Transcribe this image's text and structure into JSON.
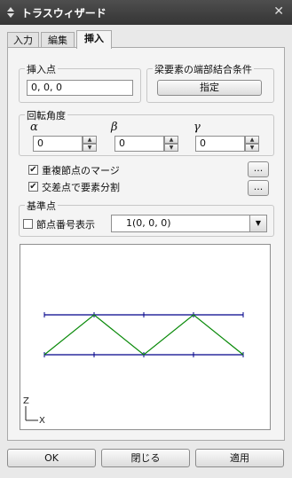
{
  "window": {
    "title": "トラスウィザード",
    "close_glyph": "✕"
  },
  "tabs": [
    {
      "label": "入力"
    },
    {
      "label": "編集"
    },
    {
      "label": "挿入"
    }
  ],
  "insert_point": {
    "title": "挿入点",
    "value": "0, 0, 0"
  },
  "beam_end": {
    "title": "梁要素の端部結合条件",
    "button_label": "指定"
  },
  "rotation": {
    "title": "回転角度",
    "alpha": {
      "symbol": "α",
      "value": "0"
    },
    "beta": {
      "symbol": "β",
      "value": "0"
    },
    "gamma": {
      "symbol": "γ",
      "value": "0"
    }
  },
  "options": {
    "merge_label": "重複節点のマージ",
    "merge_checked": true,
    "split_label": "交差点で要素分割",
    "split_checked": true,
    "more_button_label": "..."
  },
  "base_point": {
    "title": "基準点",
    "show_node_number_label": "節点番号表示",
    "show_node_number_checked": false,
    "selected_node": "1(0, 0, 0)"
  },
  "preview": {
    "axis_z": "Z",
    "axis_x": "X",
    "top_chord_color": "#00008b",
    "bottom_chord_color": "#00008b",
    "web_color": "#0a8a0a"
  },
  "footer": {
    "ok_label": "OK",
    "close_label": "閉じる",
    "apply_label": "適用"
  }
}
